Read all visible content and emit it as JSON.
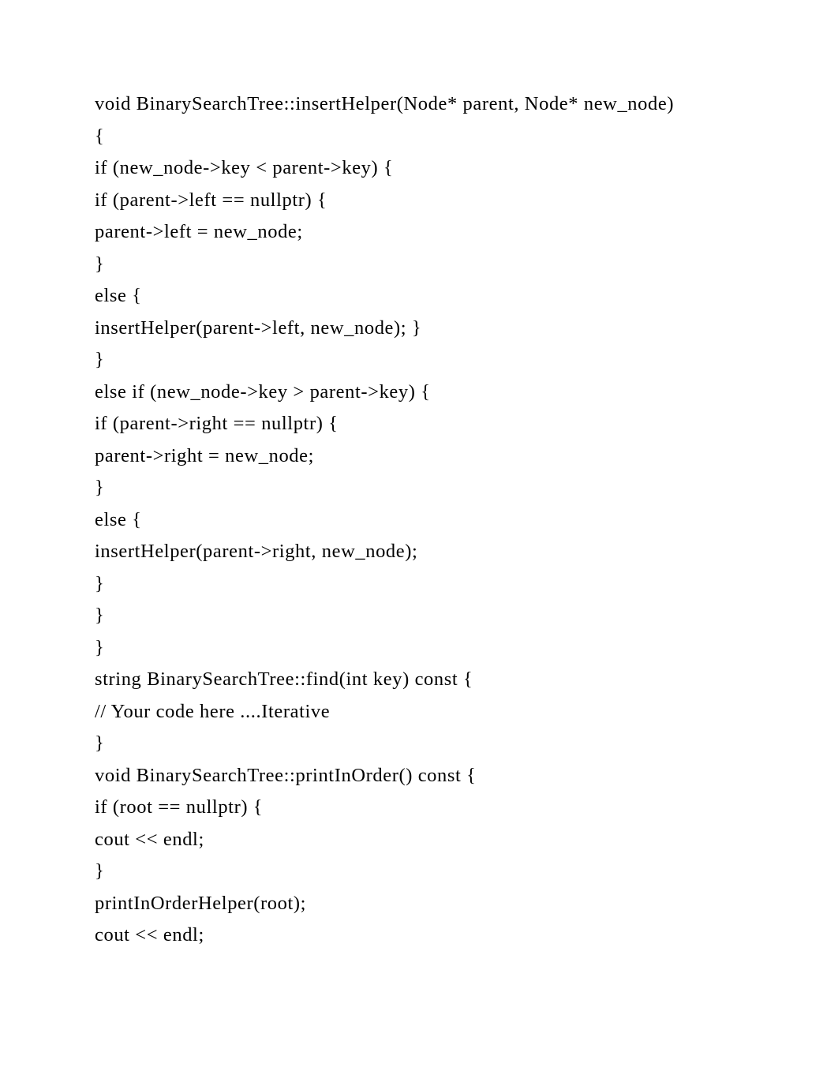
{
  "code": {
    "lines": [
      "void BinarySearchTree::insertHelper(Node* parent, Node* new_node)",
      "{",
      "if (new_node->key < parent->key) {",
      "if (parent->left == nullptr) {",
      "parent->left = new_node;",
      "}",
      "else {",
      "insertHelper(parent->left, new_node); }",
      "}",
      "else if (new_node->key > parent->key) {",
      "if (parent->right == nullptr) {",
      "parent->right = new_node;",
      "}",
      "else {",
      "insertHelper(parent->right, new_node);",
      "}",
      "}",
      "}",
      "string BinarySearchTree::find(int key) const {",
      "// Your code here ....Iterative",
      "}",
      "void BinarySearchTree::printInOrder() const {",
      "if (root == nullptr) {",
      "cout << endl;",
      "}",
      "printInOrderHelper(root);",
      "cout << endl;"
    ]
  }
}
